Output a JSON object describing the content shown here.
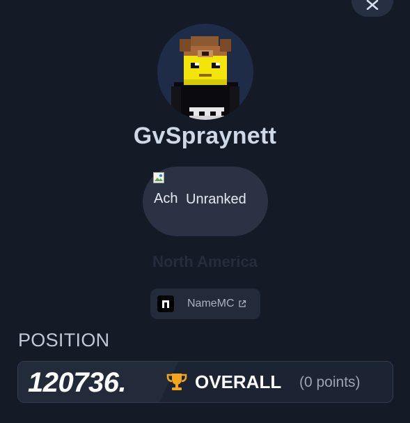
{
  "player": {
    "username": "GvSpraynett",
    "region": "North America"
  },
  "rank": {
    "icon_alt": "Ach Icon",
    "label": "Unranked"
  },
  "links": {
    "namemc_label": "NameMC"
  },
  "position": {
    "heading": "POSITION",
    "value": "120736.",
    "category": "OVERALL",
    "points": "(0 points)"
  },
  "icons": {
    "close": "close-icon",
    "trophy": "trophy-icon",
    "external": "external-link-icon",
    "namemc": "namemc-logo-icon"
  },
  "colors": {
    "background": "#141a26",
    "surface": "#2a3244",
    "trophy": "#f4a51c",
    "avatar_bg": "#1e2c47"
  }
}
